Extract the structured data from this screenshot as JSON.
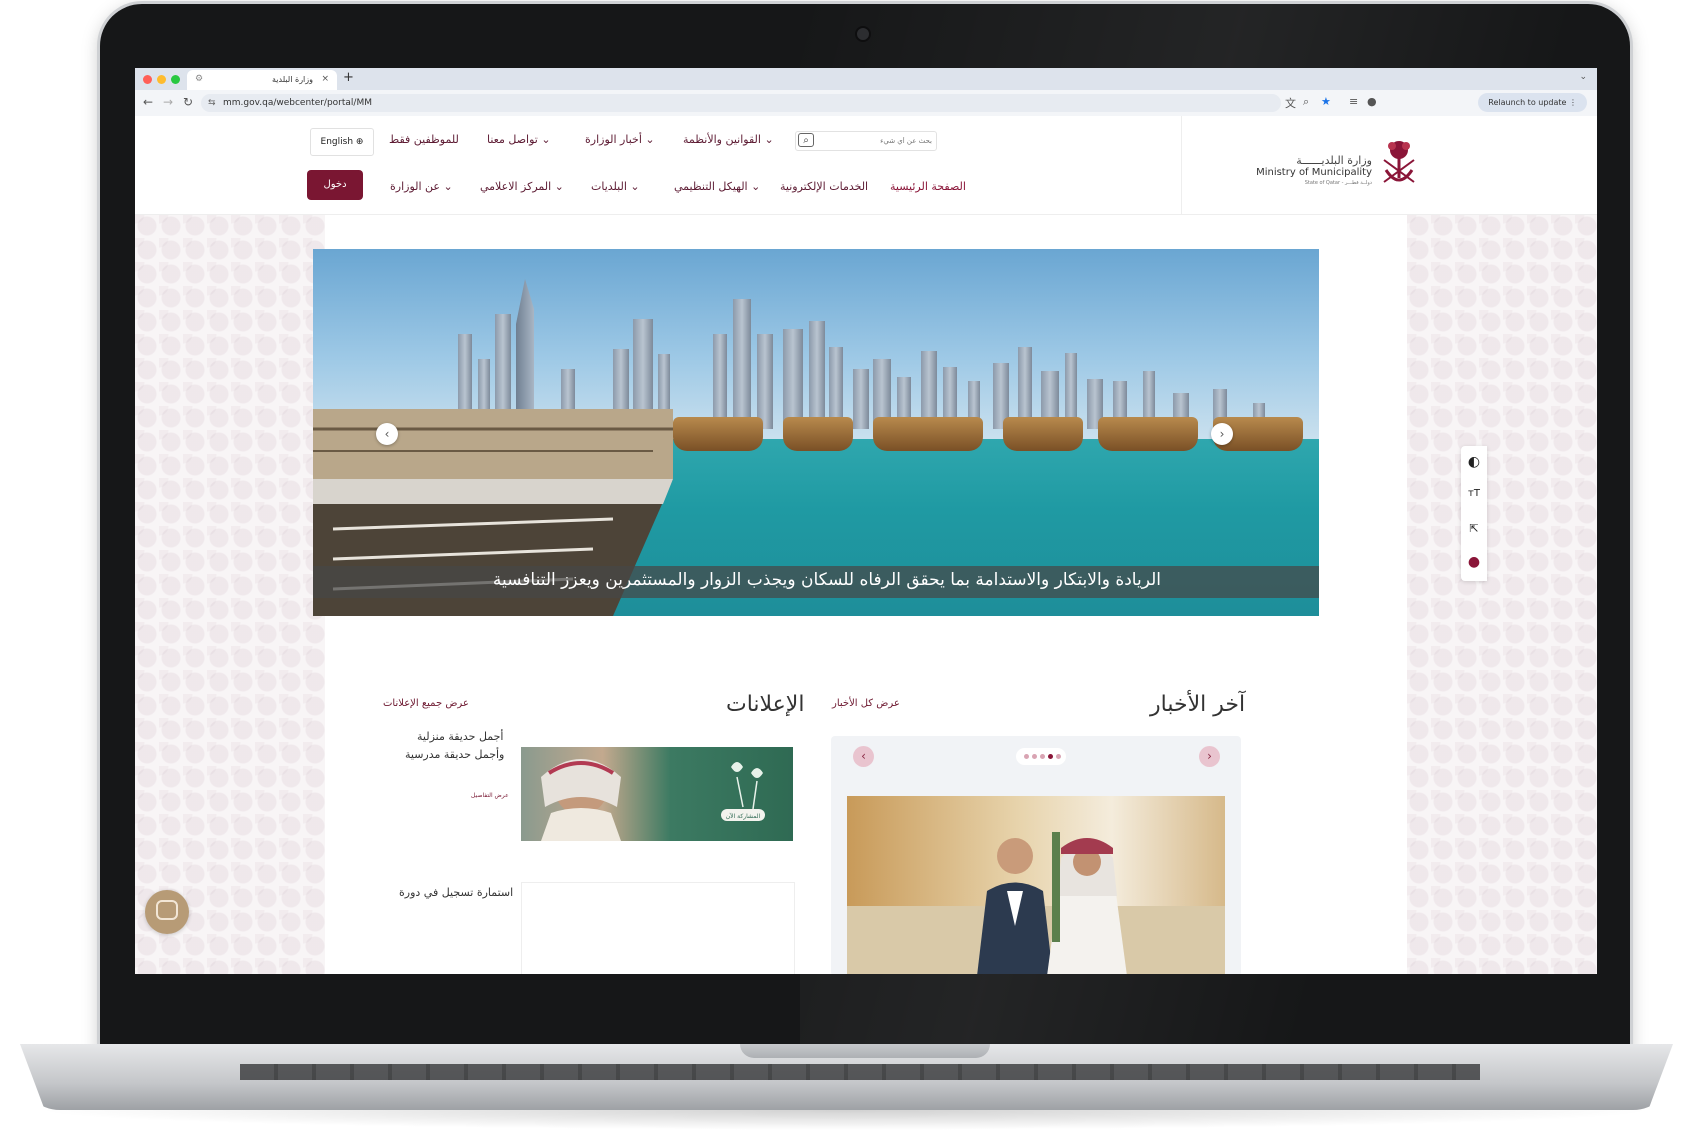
{
  "browser": {
    "tab_title": "وزارة البلدية",
    "tab_close": "×",
    "new_tab": "+",
    "url": "mm.gov.qa/webcenter/portal/MM",
    "relaunch_label": "Relaunch to update"
  },
  "site": {
    "logo": {
      "name_ar": "وزارة البلديــــــة",
      "name_en": "Ministry of Municipality",
      "state": "State of Qatar - دولــة قطـــر"
    },
    "search_placeholder": "بحث عن أي شيء",
    "top_nav": [
      "القوانين والأنظمة",
      "أخبار الوزارة",
      "تواصل معنا",
      "للموظفين فقط"
    ],
    "lang_label": "English",
    "main_nav": [
      "الصفحة الرئيسية",
      "الخدمات الإلكترونية",
      "الهيكل التنظيمي",
      "البلديات",
      "المركز الاعلامي",
      "عن الوزارة"
    ],
    "login_label": "دخول",
    "hero_caption": "الريادة والابتكار والاستدامة بما يحقق الرفاه للسكان ويجذب الزوار والمستثمرين ويعزز التنافسية",
    "news": {
      "title": "آخر الأخبار",
      "view_all": "عرض كل الأخبار"
    },
    "announcements": {
      "title": "الإعلانات",
      "view_all": "عرض جميع الإعلانات",
      "item1_line1": "أجمل حديقة منزلية",
      "item1_line2": "وأجمل حديقة مدرسية",
      "item1_more": "عرض التفاصيل",
      "item2_title": "استمارة تسجيل في دورة",
      "poster_button": "المشاركة الآن"
    }
  },
  "colors": {
    "brand": "#7a1632",
    "accent_link": "#8a1538"
  }
}
